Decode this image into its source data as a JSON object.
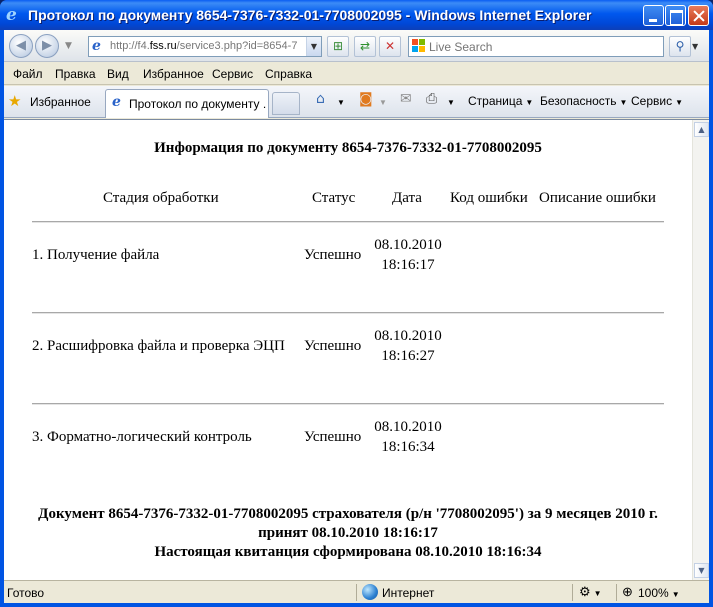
{
  "window": {
    "title": "Протокол по документу 8654-7376-7332-01-7708002095 - Windows Internet Explorer"
  },
  "navigation": {
    "back_glyph": "◀",
    "forward_glyph": "▶",
    "address_prefix": "http://f4.",
    "address_host": "fss.ru",
    "address_suffix": "/service3.php?id=8654-7",
    "search_placeholder": "Live Search"
  },
  "menu": {
    "items": [
      "Файл",
      "Правка",
      "Вид",
      "Избранное",
      "Сервис",
      "Справка"
    ]
  },
  "favbar": {
    "favorites_label": "Избранное",
    "tab_label": "Протокол по документу ...",
    "page_label": "Страница",
    "security_label": "Безопасность",
    "tools_label": "Сервис"
  },
  "document": {
    "title": "Информация по документу 8654-7376-7332-01-7708002095",
    "headers": {
      "stage": "Стадия обработки",
      "status": "Статус",
      "date": "Дата",
      "error_code": "Код ошибки",
      "error_desc": "Описание ошибки"
    },
    "rows": [
      {
        "stage": "1. Получение файла",
        "status": "Успешно",
        "date": "08.10.2010",
        "time": "18:16:17"
      },
      {
        "stage": "2. Расшифровка файла и проверка ЭЦП",
        "status": "Успешно",
        "date": "08.10.2010",
        "time": "18:16:27"
      },
      {
        "stage": "3. Форматно-логический контроль",
        "status": "Успешно",
        "date": "08.10.2010",
        "time": "18:16:34"
      }
    ],
    "footer_line1": "Документ 8654-7376-7332-01-7708002095 страхователя (р/н '7708002095') за 9 месяцев 2010 г.",
    "footer_line2": "принят 08.10.2010 18:16:17",
    "footer_line3": "Настоящая квитанция сформирована 08.10.2010 18:16:34"
  },
  "statusbar": {
    "status_text": "Готово",
    "zone_label": "Интернет",
    "zoom_label": "100%"
  }
}
